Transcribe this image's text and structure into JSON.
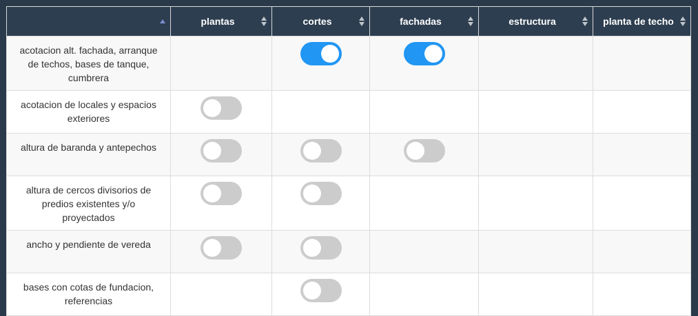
{
  "table": {
    "headers": [
      "",
      "plantas",
      "cortes",
      "fachadas",
      "estructura",
      "planta de techo"
    ],
    "rows": [
      {
        "label": "acotacion alt. fachada, arranque de techos, bases de tanque, cumbrera",
        "toggles": [
          null,
          true,
          true,
          null,
          null
        ]
      },
      {
        "label": "acotacion de locales y espacios exteriores",
        "toggles": [
          false,
          null,
          null,
          null,
          null
        ]
      },
      {
        "label": "altura de baranda y antepechos",
        "toggles": [
          false,
          false,
          false,
          null,
          null
        ]
      },
      {
        "label": "altura de cercos divisorios de predios existentes y/o proyectados",
        "toggles": [
          false,
          false,
          null,
          null,
          null
        ]
      },
      {
        "label": "ancho y pendiente de vereda",
        "toggles": [
          false,
          false,
          null,
          null,
          null
        ]
      },
      {
        "label": "bases con cotas de fundacion, referencias",
        "toggles": [
          null,
          false,
          null,
          null,
          null
        ]
      }
    ]
  },
  "colors": {
    "header_bg": "#2d3e50",
    "toggle_on": "#2196f3",
    "toggle_off": "#cccccc"
  }
}
